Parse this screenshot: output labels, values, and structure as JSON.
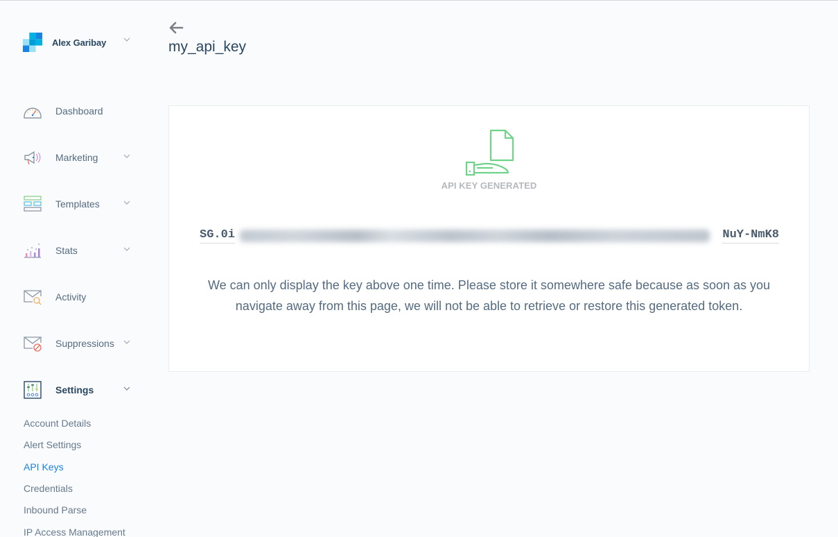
{
  "account": {
    "name": "Alex Garibay",
    "logo_icon": "sendgrid-logo-icon",
    "chevron_icon": "chevron-down-icon"
  },
  "sidebar": {
    "items": [
      {
        "label": "Dashboard",
        "icon": "dashboard-gauge-icon",
        "has_chevron": false,
        "active": false
      },
      {
        "label": "Marketing",
        "icon": "megaphone-icon",
        "has_chevron": true,
        "active": false
      },
      {
        "label": "Templates",
        "icon": "templates-layout-icon",
        "has_chevron": true,
        "active": false
      },
      {
        "label": "Stats",
        "icon": "bar-chart-icon",
        "has_chevron": true,
        "active": false
      },
      {
        "label": "Activity",
        "icon": "envelope-search-icon",
        "has_chevron": false,
        "active": false
      },
      {
        "label": "Suppressions",
        "icon": "envelope-blocked-icon",
        "has_chevron": true,
        "active": false
      },
      {
        "label": "Settings",
        "icon": "settings-sliders-icon",
        "has_chevron": true,
        "active": true
      }
    ],
    "settings_subitems": [
      {
        "label": "Account Details",
        "active": false
      },
      {
        "label": "Alert Settings",
        "active": false
      },
      {
        "label": "API Keys",
        "active": true
      },
      {
        "label": "Credentials",
        "active": false
      },
      {
        "label": "Inbound Parse",
        "active": false
      },
      {
        "label": "IP Access Management",
        "active": false
      }
    ]
  },
  "header": {
    "back_icon": "arrow-left-icon",
    "title": "my_api_key"
  },
  "card": {
    "illustration_icon": "hand-document-icon",
    "status_label": "API KEY GENERATED",
    "key_visible_prefix": "SG.0i",
    "key_visible_suffix": "NuY-NmK8",
    "key_middle_obscured": true,
    "notice": "We can only display the key above one time. Please store it somewhere safe because as soon as you navigate away from this page, we will not be able to retrieve or restore this generated token."
  },
  "colors": {
    "accent_blue": "#1a82e2",
    "illustration_green": "#6fd38a",
    "heading_navy": "#294661",
    "body_text": "#546b81",
    "muted_label": "#b5b9bd"
  }
}
